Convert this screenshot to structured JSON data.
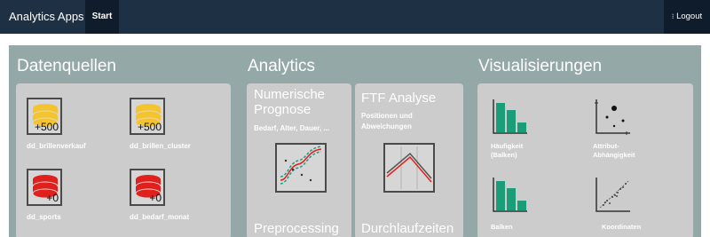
{
  "navbar": {
    "brand": "Analytics Apps",
    "tab_start": "Start",
    "logout": "Logout",
    "logout_icon": "logout-icon"
  },
  "sections": {
    "datenquellen": {
      "title": "Datenquellen",
      "items": [
        {
          "label": "dd_brillenverkauf",
          "badge": "+500",
          "color": "#f4c430",
          "icon": "database-icon"
        },
        {
          "label": "dd_brillen_cluster",
          "badge": "+500",
          "color": "#f4c430",
          "icon": "database-icon"
        },
        {
          "label": "dd_sports",
          "badge": "+0",
          "color": "#e0201c",
          "icon": "database-icon"
        },
        {
          "label": "dd_bedarf_monat",
          "badge": "+0",
          "color": "#e0201c",
          "icon": "database-icon"
        }
      ]
    },
    "analytics": {
      "title": "Analytics",
      "cards": [
        {
          "title": "Numerische Prognose",
          "subtitle": "Bedarf, Alter, Dauer, ...",
          "icon": "forecast-chart-icon"
        },
        {
          "title": "FTF Analyse",
          "subtitle": "Positionen und Abweichungen",
          "icon": "line-chart-icon"
        },
        {
          "title": "Preprocessing",
          "subtitle": "",
          "icon": ""
        },
        {
          "title": "Durchlaufzeiten",
          "subtitle": "",
          "icon": ""
        }
      ]
    },
    "visualisierungen": {
      "title": "Visualisierungen",
      "items": [
        {
          "label": "Häufigkeit (Balken)",
          "icon": "bar-chart-icon"
        },
        {
          "label": "Attribut-Abhängigkeit",
          "icon": "scatter-plot-icon"
        },
        {
          "label": "Balken",
          "icon": "bar-chart-icon"
        },
        {
          "label": "Koordinaten",
          "icon": "scatter-trend-icon"
        }
      ]
    }
  },
  "colors": {
    "navbar": "#1e3044",
    "navbar_active": "#0f1c2b",
    "panel": "#94a8a8",
    "card": "#cccccc",
    "bar_green": "#1a9e7a",
    "line_red": "#e0201c",
    "line_teal": "#1a9e8a"
  }
}
